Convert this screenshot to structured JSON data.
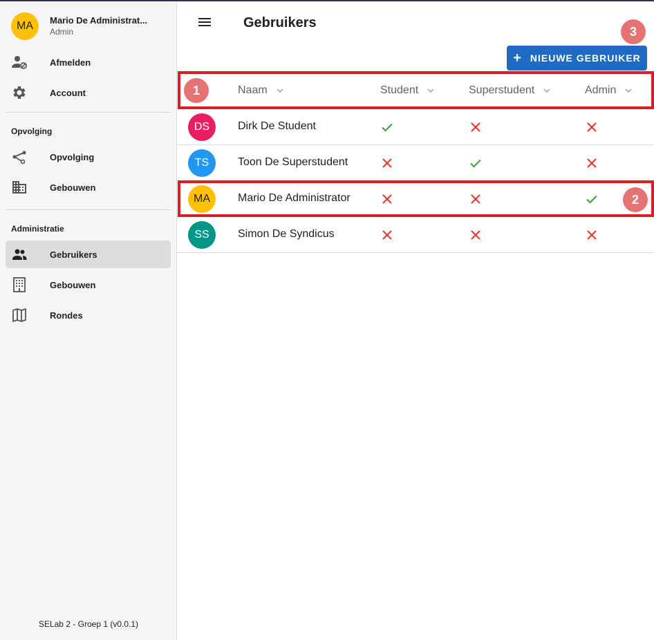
{
  "sidebar": {
    "user": {
      "initials": "MA",
      "name": "Mario De Administrat...",
      "role": "Admin",
      "avatar_color": "#ffc107"
    },
    "top_items": [
      {
        "label": "Afmelden",
        "icon": "person-off-icon"
      },
      {
        "label": "Account",
        "icon": "gear-icon"
      }
    ],
    "sections": [
      {
        "title": "Opvolging",
        "items": [
          {
            "label": "Opvolging",
            "icon": "route-icon"
          },
          {
            "label": "Gebouwen",
            "icon": "building-icon"
          }
        ]
      },
      {
        "title": "Administratie",
        "items": [
          {
            "label": "Gebruikers",
            "icon": "people-icon",
            "active": true
          },
          {
            "label": "Gebouwen",
            "icon": "office-building-icon"
          },
          {
            "label": "Rondes",
            "icon": "map-icon"
          }
        ]
      }
    ],
    "footer": "SELab 2 - Groep 1 (v0.0.1)"
  },
  "header": {
    "title": "Gebruikers",
    "new_button_label": "NIEUWE GEBRUIKER"
  },
  "table": {
    "columns": [
      "Naam",
      "Student",
      "Superstudent",
      "Admin"
    ],
    "rows": [
      {
        "initials": "DS",
        "name": "Dirk De Student",
        "color": "#e91e63",
        "student": true,
        "superstudent": false,
        "admin": false
      },
      {
        "initials": "TS",
        "name": "Toon De Superstudent",
        "color": "#2196f3",
        "student": false,
        "superstudent": true,
        "admin": false
      },
      {
        "initials": "MA",
        "name": "Mario De Administrator",
        "color": "#ffc107",
        "student": false,
        "superstudent": false,
        "admin": true
      },
      {
        "initials": "SS",
        "name": "Simon De Syndicus",
        "color": "#009688",
        "student": false,
        "superstudent": false,
        "admin": false
      }
    ]
  },
  "annotations": {
    "badge_1": "1",
    "badge_2": "2",
    "badge_3": "3",
    "highlight_color": "#d81f26"
  }
}
